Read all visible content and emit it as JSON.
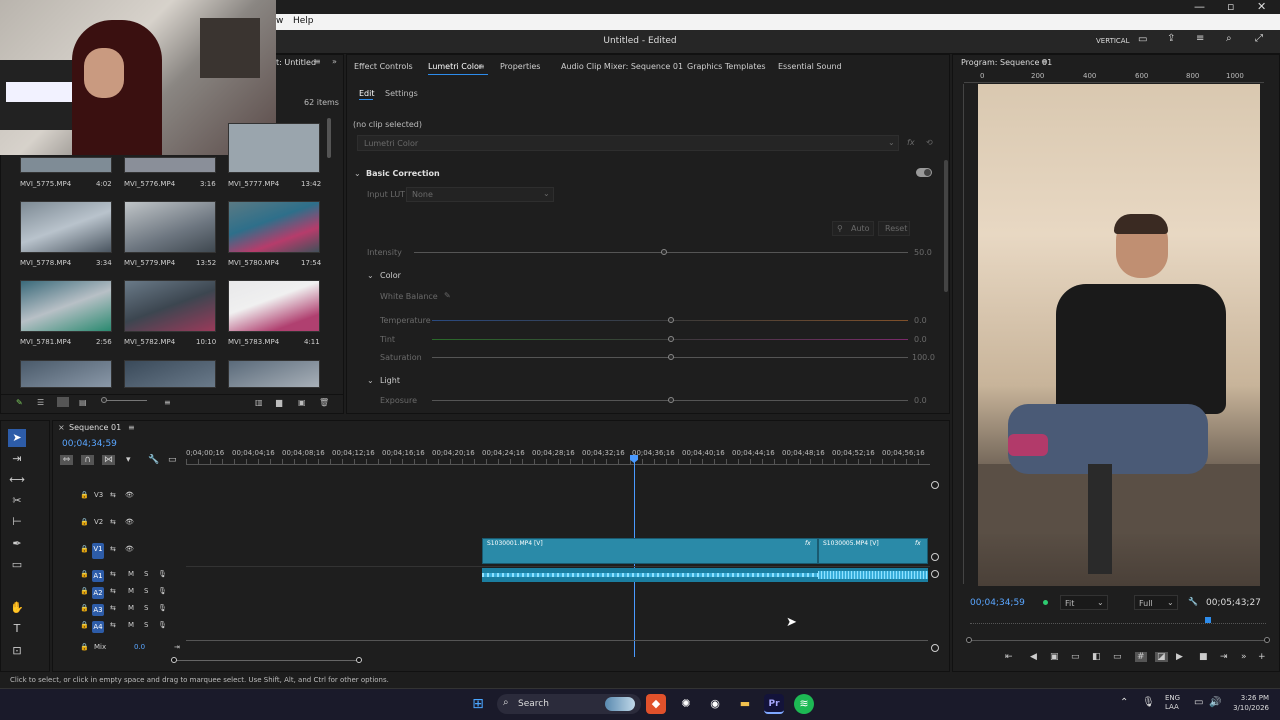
{
  "menu": {
    "help": "Help",
    "partial": "w"
  },
  "window": {
    "title": "Untitled - Edited",
    "layout": "VERTICAL"
  },
  "project": {
    "tab": "t: Untitled",
    "count": "62 items",
    "clips": [
      {
        "name": "MVI_5775.MP4",
        "dur": "4:02"
      },
      {
        "name": "MVI_5776.MP4",
        "dur": "3:16"
      },
      {
        "name": "MVI_5777.MP4",
        "dur": "13:42"
      },
      {
        "name": "MVI_5778.MP4",
        "dur": "3:34"
      },
      {
        "name": "MVI_5779.MP4",
        "dur": "13:52"
      },
      {
        "name": "MVI_5780.MP4",
        "dur": "17:54"
      },
      {
        "name": "MVI_5781.MP4",
        "dur": "2:56"
      },
      {
        "name": "MVI_5782.MP4",
        "dur": "10:10"
      },
      {
        "name": "MVI_5783.MP4",
        "dur": "4:11"
      }
    ]
  },
  "tabs": {
    "effect_controls": "Effect Controls",
    "lumetri": "Lumetri Color",
    "properties": "Properties",
    "audio_mixer": "Audio Clip Mixer: Sequence 01",
    "graphics": "Graphics Templates",
    "essential_sound": "Essential Sound"
  },
  "lumetri": {
    "edit": "Edit",
    "settings": "Settings",
    "no_clip": "(no clip selected)",
    "dropdown": "Lumetri Color",
    "basic": "Basic Correction",
    "input_lut": "Input LUT",
    "lut_value": "None",
    "auto": "Auto",
    "reset": "Reset",
    "intensity": "Intensity",
    "intensity_val": "50.0",
    "color": "Color",
    "white_balance": "White Balance",
    "temperature": "Temperature",
    "temp_val": "0.0",
    "tint": "Tint",
    "tint_val": "0.0",
    "saturation": "Saturation",
    "sat_val": "100.0",
    "light": "Light",
    "exposure": "Exposure",
    "exp_val": "0.0"
  },
  "program": {
    "title": "Program: Sequence 01",
    "ruler": [
      "0",
      "200",
      "400",
      "600",
      "800",
      "1000"
    ],
    "timecode": "00;04;34;59",
    "fit": "Fit",
    "full": "Full",
    "duration": "00;05;43;27"
  },
  "timeline": {
    "tab": "Sequence 01",
    "timecode": "00;04;34;59",
    "ruler": [
      "0;04;00;16",
      "00;04;04;16",
      "00;04;08;16",
      "00;04;12;16",
      "00;04;16;16",
      "00;04;20;16",
      "00;04;24;16",
      "00;04;28;16",
      "00;04;32;16",
      "00;04;36;16",
      "00;04;40;16",
      "00;04;44;16",
      "00;04;48;16",
      "00;04;52;16",
      "00;04;56;16"
    ],
    "tracks": {
      "v3": "V3",
      "v2": "V2",
      "v1": "V1",
      "a1": "A1",
      "a2": "A2",
      "a3": "A3",
      "a4": "A4",
      "mix": "Mix",
      "mix_val": "0.0"
    },
    "clip1": "S1030001.MP4 [V]",
    "clip2": "S1030005.MP4 [V]",
    "fx": "fx",
    "m": "M",
    "s": "S"
  },
  "status": "Click to select, or click in empty space and drag to marquee select. Use Shift, Alt, and Ctrl for other options.",
  "taskbar": {
    "search": "Search",
    "lang1": "ENG",
    "lang2": "LAA",
    "time": "3:26 PM",
    "date": "3/10/2026"
  },
  "colors": {
    "accent": "#2d8ceb",
    "clip": "#2a8aa8",
    "audio": "#3aaeda"
  }
}
